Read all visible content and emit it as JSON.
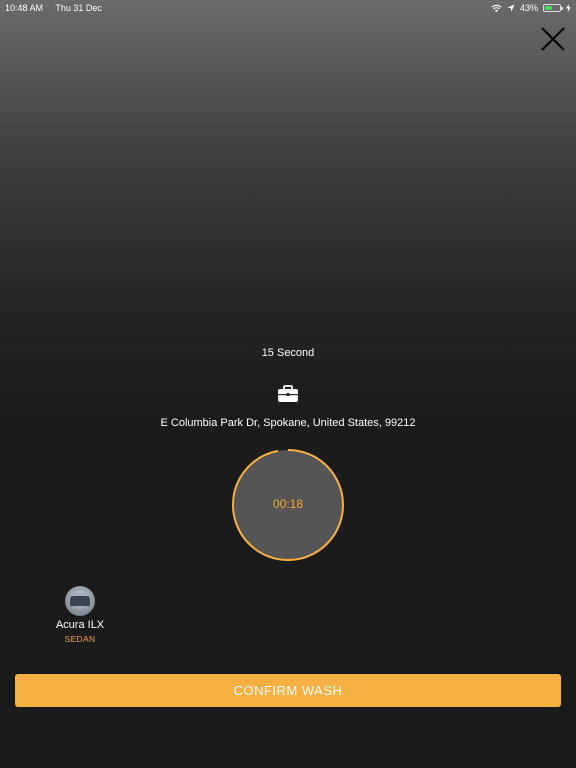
{
  "status_bar": {
    "time": "10:48 AM",
    "date": "Thu 31 Dec",
    "battery_percent_text": "43%",
    "battery_level": 0.43,
    "icons": [
      "wifi-icon",
      "location-arrow-icon",
      "battery-icon",
      "charging-bolt-icon"
    ]
  },
  "header": {
    "close_icon": "close-icon"
  },
  "wash": {
    "duration_text": "15 Second",
    "location_icon": "briefcase-icon",
    "address": "E Columbia Park Dr, Spokane, United States, 99212",
    "timer_text": "00:18",
    "timer_progress": 0.97
  },
  "vehicle": {
    "name": "Acura ILX",
    "type": "SEDAN"
  },
  "actions": {
    "confirm_label": "CONFIRM WASH"
  },
  "colors": {
    "accent": "#f6b041",
    "accent_text": "#f2a533",
    "timer_fill": "#555555",
    "background_dark": "#1a1a1a"
  }
}
